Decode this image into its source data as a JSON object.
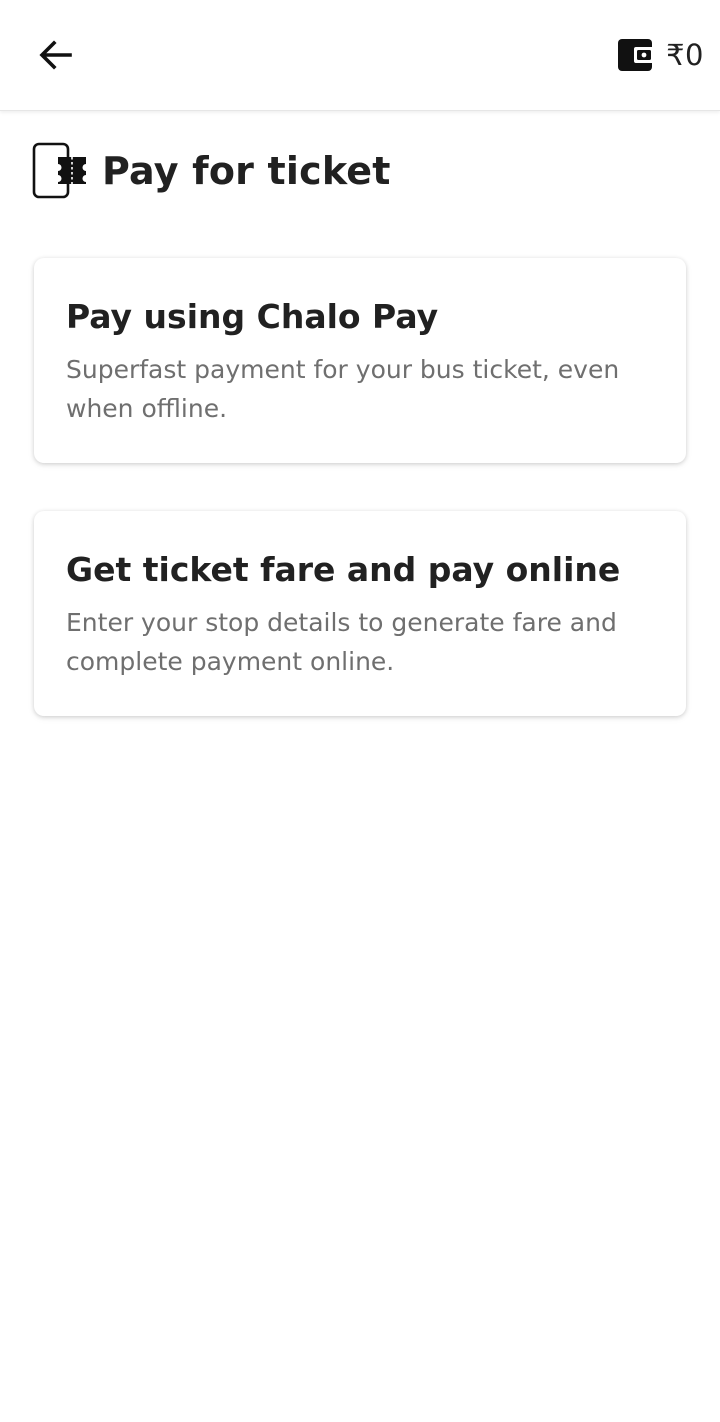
{
  "app_bar": {
    "back_icon": "arrow-left-icon",
    "wallet_icon": "wallet-icon",
    "wallet_balance": "₹0"
  },
  "page": {
    "header_icon": "ticket-icon",
    "title": "Pay for ticket"
  },
  "options": [
    {
      "title": "Pay using Chalo Pay",
      "description": "Superfast payment for your bus ticket, even when offline."
    },
    {
      "title": "Get ticket fare and pay online",
      "description": "Enter your stop details to generate fare and complete payment online."
    }
  ],
  "colors": {
    "text_primary": "#212121",
    "text_secondary": "#6f6f6f",
    "background": "#ffffff"
  }
}
